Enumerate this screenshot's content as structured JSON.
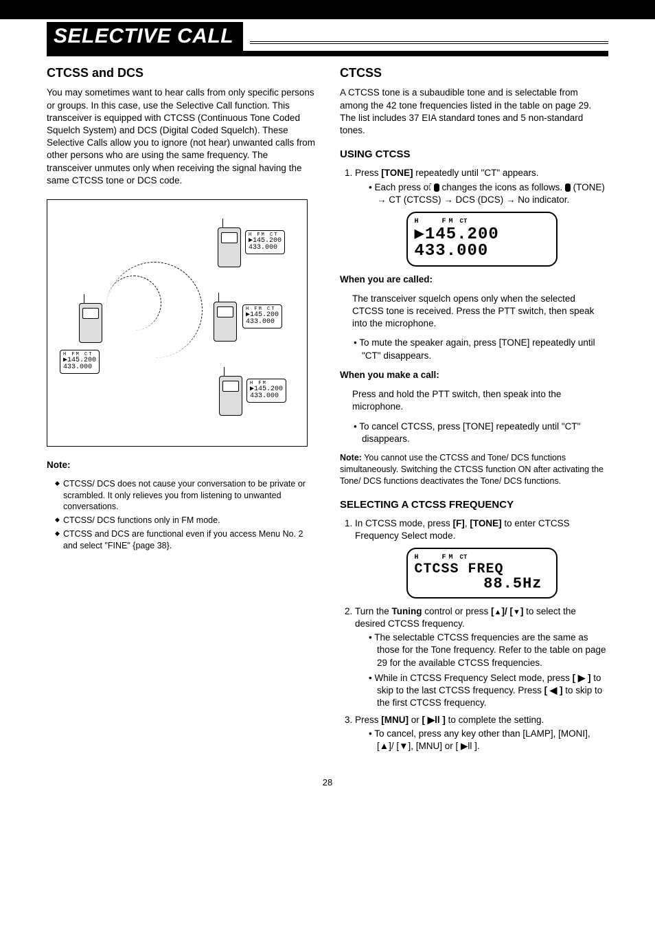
{
  "title": "SELECTIVE CALL",
  "left": {
    "h2": "CTCSS and DCS",
    "p1": "You may sometimes want to hear calls from only specific persons or groups. In this case, use the Selective Call function. This transceiver is equipped with CTCSS (Continuous Tone Coded Squelch System) and DCS (Digital Coded Squelch). These Selective Calls allow you to ignore (not hear) unwanted calls from other persons who are using the same frequency. The transceiver unmutes only when receiving the signal having the same CTCSS tone or DCS code.",
    "fig": {
      "top": {
        "h": "H",
        "fm": "FM",
        "ct": "CT",
        "l1": "▶145.200",
        "l2": " 433.000"
      },
      "mid": {
        "h": "H",
        "fm": "FM",
        "ct": "CT",
        "l1": "▶145.200",
        "l2": " 433.000"
      },
      "bot": {
        "h": "H",
        "fm": "FM",
        "l1": "▶145.200",
        "l2": " 433.000"
      },
      "left": {
        "h": "H",
        "fm": "FM",
        "ct": "CT",
        "l1": "▶145.200",
        "l2": " 433.000"
      }
    },
    "note_head": "Note:",
    "notes": [
      "CTCSS/ DCS does not cause your conversation to be private or scrambled. It only relieves you from listening to unwanted conversations.",
      "CTCSS/ DCS functions only in FM mode.",
      "CTCSS and DCS are functional even if you access Menu No. 2 and select \"FINE\" {page 38}."
    ]
  },
  "right": {
    "h2": "CTCSS",
    "p1": "A CTCSS tone is a subaudible tone and is selectable from among the 42 tone frequencies listed in the table on page 29. The list includes 37 EIA standard tones and 5 non-standard tones.",
    "h3a": "USING CTCSS",
    "step1_a": "Press ",
    "step1_key": "[TONE]",
    "step1_b": " repeatedly until \"CT\" appears.",
    "step1_bullet_a": "Each press of ",
    "step1_bullet_b": " changes the icons as follows. ",
    "step1_bullet_c": " (TONE) → CT (CTCSS) → DCS (DCS) → No indicator.",
    "lcd1": {
      "h": "H",
      "fm": "FM",
      "ct": "CT",
      "l1": "▶145.200",
      "l2": " 433.000"
    },
    "calling": "When you are called:",
    "call_p": "The transceiver squelch opens only when the selected CTCSS tone is received. Press the PTT switch, then speak into the microphone.",
    "call_bullet": "To mute the speaker again, press [TONE] repeatedly until \"CT\" disappears.",
    "making": "When you make a call:",
    "make_p": "Press and hold the PTT switch, then speak into the microphone.",
    "make_bullet": "To cancel CTCSS, press [TONE] repeatedly until \"CT\" disappears.",
    "ct_note_head": "Note:",
    "ct_note": " You cannot use the CTCSS and Tone/ DCS functions simultaneously. Switching the CTCSS function ON after activating the Tone/ DCS functions deactivates the Tone/ DCS functions.",
    "h3b": "SELECTING A CTCSS FREQUENCY",
    "sel_step1_a": "In CTCSS mode, press ",
    "sel_step1_key1": "[F]",
    "sel_step1_key2": "[TONE]",
    "sel_step1_b": " to enter CTCSS Frequency Select mode.",
    "lcd2": {
      "h": "H",
      "fm": "FM",
      "ct": "CT",
      "l1": "CTCSS  FREQ",
      "l2": "88.5Hz"
    },
    "sel_step2_a": "Turn the ",
    "sel_step2_tune": "Tuning",
    "sel_step2_b": " control or press ",
    "sel_step2_c": " to select the desired CTCSS frequency.",
    "sel_bullet1": "The selectable CTCSS frequencies are the same as those for the Tone frequency. Refer to the table on page 29 for the available CTCSS frequencies.",
    "sel_bullet2_a": "While in CTCSS Frequency Select mode, press ",
    "sel_bullet2_b": " to skip to the last CTCSS frequency. Press ",
    "sel_bullet2_c": " to skip to the first CTCSS frequency.",
    "sel_step3_a": "Press ",
    "sel_step3_key": "[MNU]",
    "sel_step3_b": " or ",
    "sel_step3_c": " to complete the setting.",
    "sel_cancel": "To cancel, press any key other than [LAMP], [MONI], [▲]/ [▼], [MNU] or [ ▶ll ].",
    "ptt": "[ ▶ll ]"
  },
  "page_number": "28"
}
